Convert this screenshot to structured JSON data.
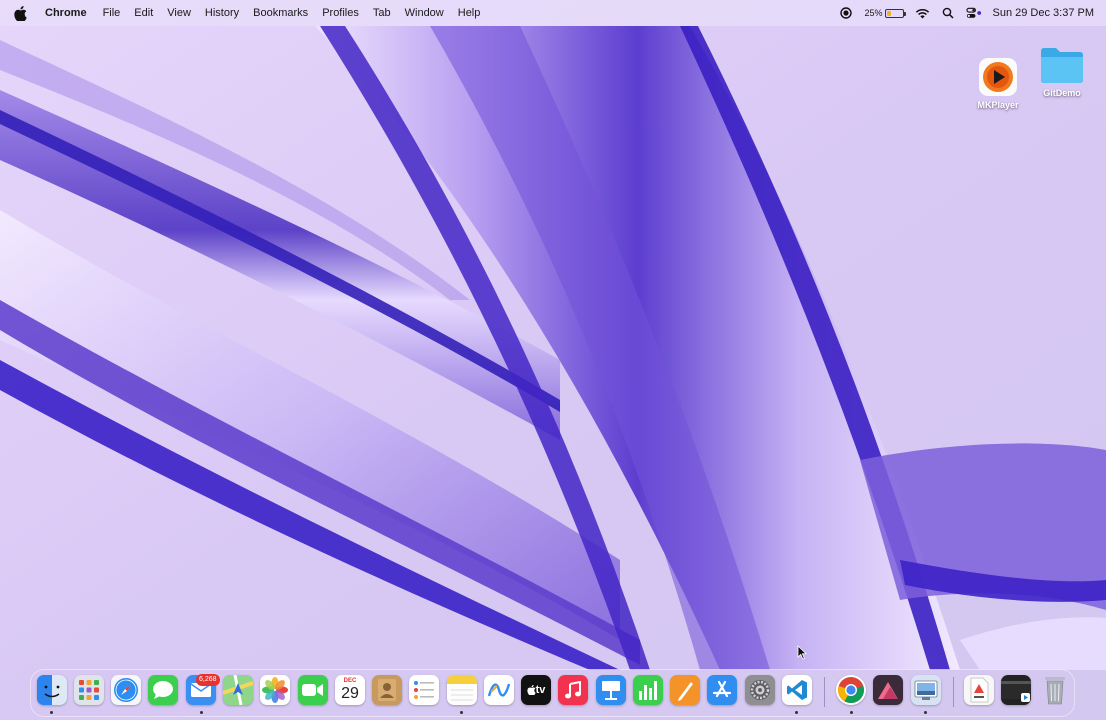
{
  "menubar": {
    "app_name": "Chrome",
    "items": [
      "File",
      "Edit",
      "View",
      "History",
      "Bookmarks",
      "Profiles",
      "Tab",
      "Window",
      "Help"
    ],
    "battery_percent": "25%",
    "battery_level": 0.25,
    "datetime": "Sun 29 Dec  3:37 PM"
  },
  "desktop": {
    "icons": [
      {
        "label": "MKPlayer",
        "icon": "play-icon"
      },
      {
        "label": "GitDemo",
        "icon": "folder-icon"
      }
    ]
  },
  "dock": {
    "mail_badge": "6,268",
    "calendar_month": "DEC",
    "calendar_day": "29",
    "tv_label": "tv",
    "apps": [
      "Finder",
      "Launchpad",
      "Safari",
      "Messages",
      "Mail",
      "Maps",
      "Photos",
      "FaceTime",
      "Calendar",
      "Contacts",
      "Reminders",
      "Notes",
      "Freeform",
      "TV",
      "Music",
      "Keynote",
      "Numbers",
      "Pages",
      "App Store",
      "System Settings",
      "Visual Studio Code",
      "Google Chrome",
      "Affinity",
      "Preview",
      "Document",
      "Terminal",
      "Trash"
    ]
  },
  "colors": {
    "wallpaper_base": "#d9ccf5",
    "ribbon_dark": "#4a2dbf",
    "badge": "#e8322f"
  }
}
